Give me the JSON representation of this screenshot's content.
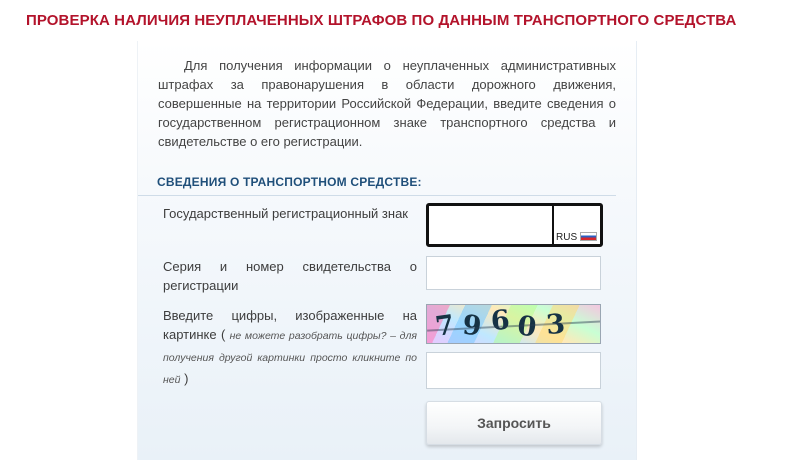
{
  "page": {
    "title": "ПРОВЕРКА НАЛИЧИЯ НЕУПЛАЧЕННЫХ ШТРАФОВ ПО ДАННЫМ ТРАНСПОРТНОГО СРЕДСТВА"
  },
  "intro": "Для получения информации о неуплаченных административных штрафах за правонарушения в области дорожного движения, совершенные на территории Российской Федерации, введите сведения о государственном регистрационном знаке транспортного средства и свидетельстве о его регистрации.",
  "section": {
    "title": "СВЕДЕНИЯ О ТРАНСПОРТНОМ СРЕДСТВЕ:"
  },
  "form": {
    "plate_label": "Государственный регистрационный знак",
    "plate_number": "",
    "plate_region": "",
    "plate_country": "RUS",
    "certificate_label": "Серия и номер свидетельства о регистрации",
    "certificate_value": "",
    "captcha_label": "Введите цифры, изображенные на картинке",
    "captcha_hint": "не можете разобрать цифры? – для получения другой картинки просто кликните по ней",
    "captcha_digits": [
      "7",
      "9",
      "6",
      "0",
      "3"
    ],
    "captcha_value": "",
    "submit_label": "Запросить"
  },
  "colors": {
    "title": "#b3132b",
    "section_title": "#1f4f7a",
    "panel_gradient_end": "#e9f1f8"
  }
}
